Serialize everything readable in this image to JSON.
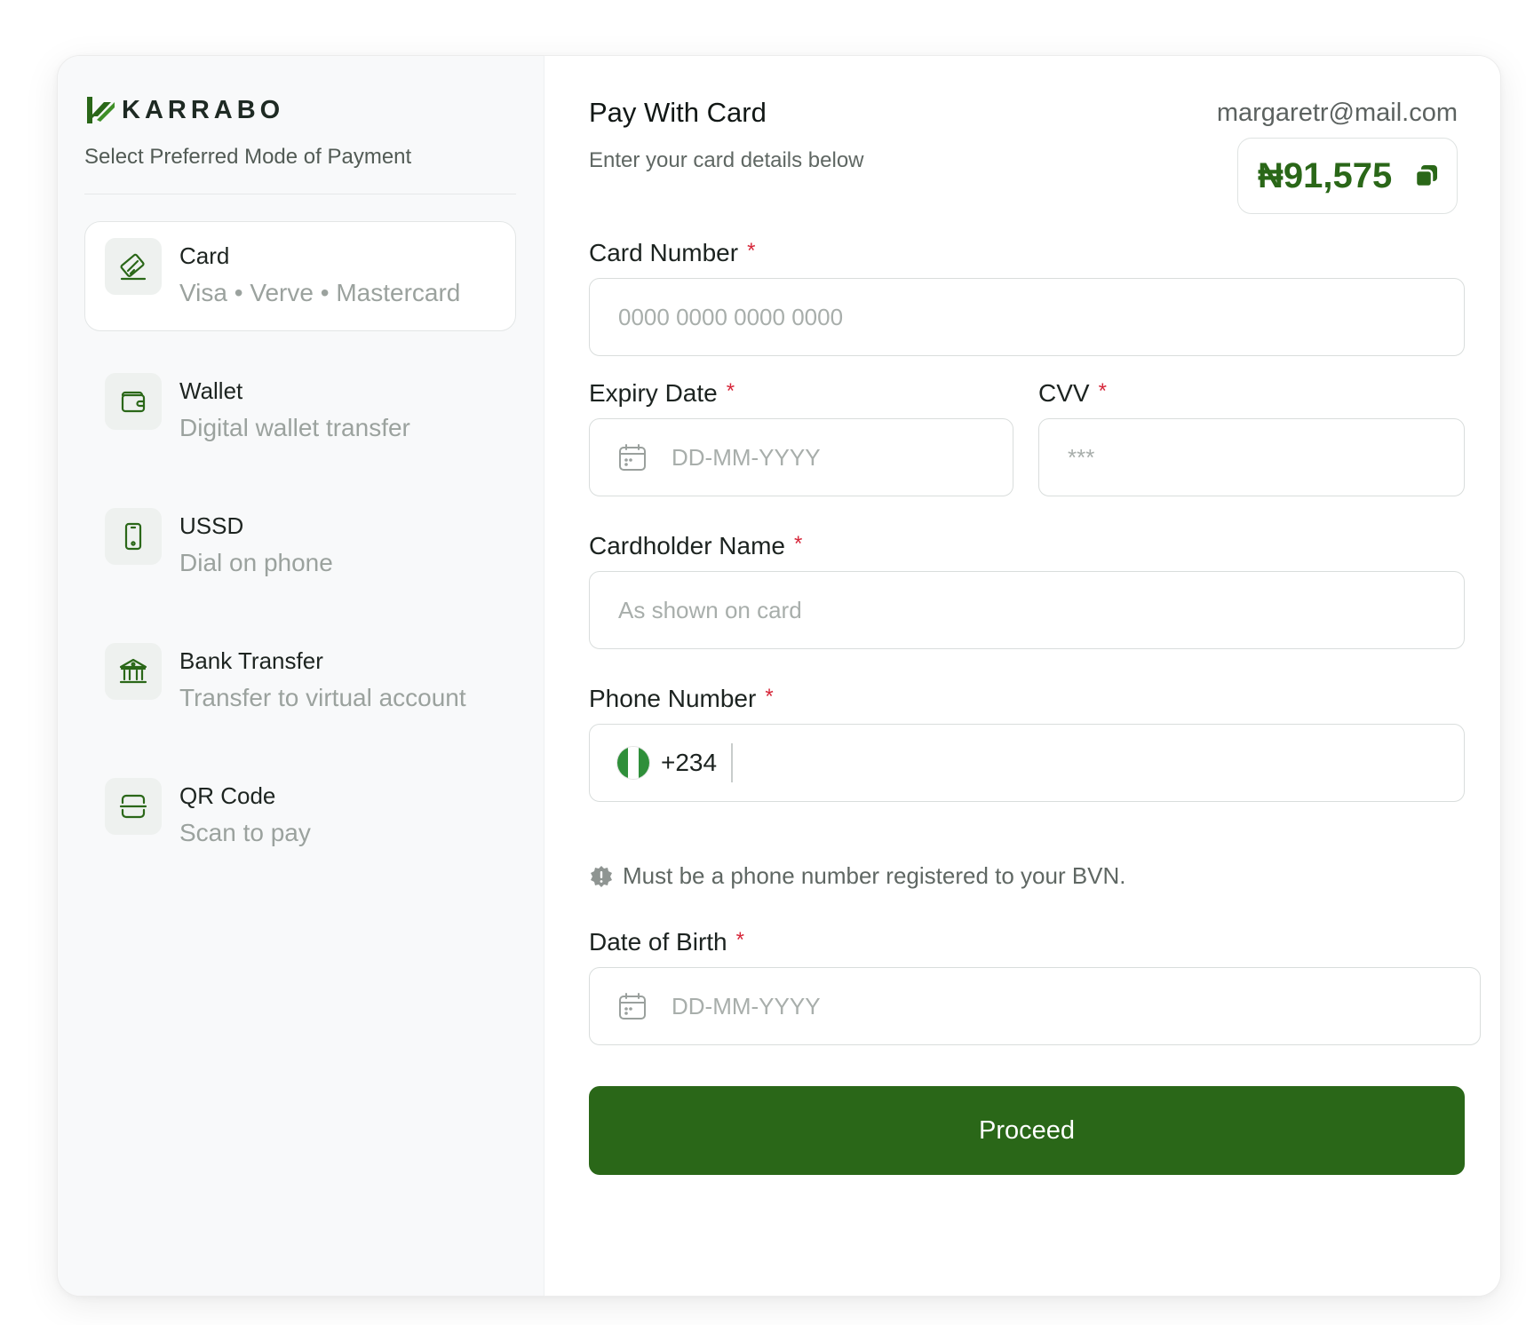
{
  "brand": {
    "name": "KARRABO",
    "color": "#2a6718"
  },
  "sidebar": {
    "subtitle": "Select Preferred Mode of Payment",
    "methods": [
      {
        "title": "Card",
        "subtitle_parts": [
          "Visa",
          "Verve",
          "Mastercard"
        ],
        "separator": "•",
        "icon": "card-icon",
        "active": true
      },
      {
        "title": "Wallet",
        "subtitle": "Digital wallet transfer",
        "icon": "wallet-icon",
        "active": false
      },
      {
        "title": "USSD",
        "subtitle": "Dial on phone",
        "icon": "phone-icon",
        "active": false
      },
      {
        "title": "Bank Transfer",
        "subtitle": "Transfer to virtual account",
        "icon": "bank-icon",
        "active": false
      },
      {
        "title": "QR Code",
        "subtitle": "Scan to pay",
        "icon": "qr-code-icon",
        "active": false
      }
    ]
  },
  "header": {
    "title": "Pay With Card",
    "subtitle": "Enter your card details below",
    "email": "margaretr@mail.com",
    "amount": "₦91,575"
  },
  "form": {
    "required_mark": "*",
    "card_number": {
      "label": "Card Number",
      "placeholder": "0000 0000 0000 0000",
      "value": ""
    },
    "expiry_date": {
      "label": "Expiry Date",
      "placeholder": "DD-MM-YYYY",
      "value": ""
    },
    "cvv": {
      "label": "CVV",
      "placeholder": "***",
      "value": ""
    },
    "cardholder_name": {
      "label": "Cardholder Name",
      "placeholder": "As shown on card",
      "value": ""
    },
    "phone_number": {
      "label": "Phone Number",
      "country_code": "+234",
      "value": "",
      "hint": "Must be a phone number registered to your BVN."
    },
    "date_of_birth": {
      "label": "Date of Birth",
      "placeholder": "DD-MM-YYYY",
      "value": ""
    },
    "proceed_label": "Proceed"
  },
  "colors": {
    "accent": "#2a6718",
    "required": "#d6273a",
    "flag_green": "#2f8f3a"
  }
}
